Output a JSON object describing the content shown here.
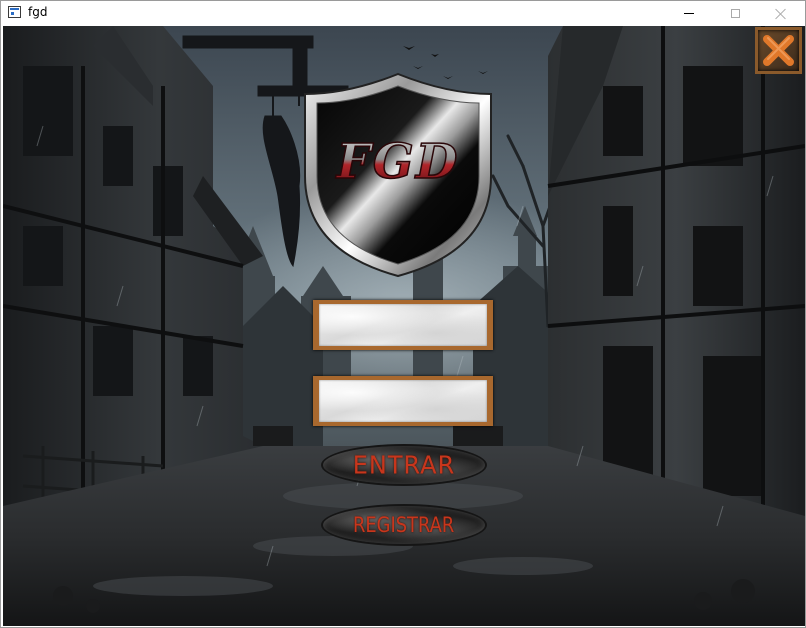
{
  "window": {
    "title": "fgd"
  },
  "logo": {
    "text": "FGD"
  },
  "login": {
    "username_value": "",
    "password_value": ""
  },
  "buttons": {
    "entrar_label": "ENTRAR",
    "registrar_label": "REGISTRAR"
  },
  "icons": {
    "app": "window-app-icon",
    "minimize": "minimize-icon",
    "maximize": "maximize-icon",
    "close": "close-icon",
    "corner_close": "corner-close-x-icon"
  },
  "colors": {
    "button_text": "#c8361c",
    "field_border": "#a8682e",
    "corner_x": "#e0782a",
    "shield_letters": "#b0252a"
  }
}
